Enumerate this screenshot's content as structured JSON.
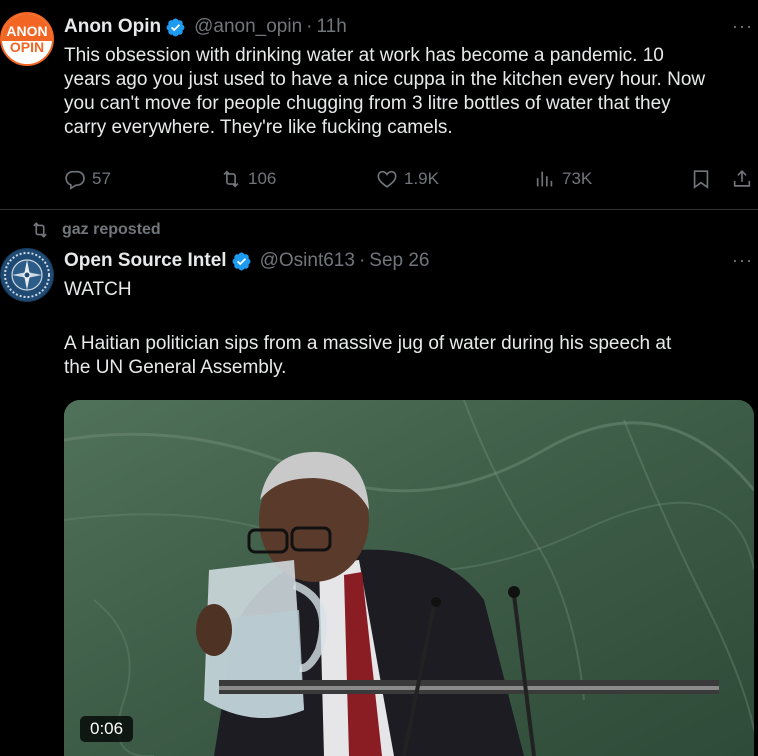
{
  "tweet1": {
    "avatar_lines": [
      "ANON",
      "OPIN"
    ],
    "display_name": "Anon Opin",
    "handle": "@anon_opin",
    "separator": "·",
    "time": "11h",
    "more": "···",
    "text_lines": [
      "This obsession with drinking water at work has become a pandemic. 10",
      "years ago you just used to have a nice cuppa in the kitchen every hour. Now",
      "you can't move for people chugging from 3 litre bottles of water that they",
      "carry everywhere. They're like fucking camels."
    ],
    "replies": "57",
    "reposts": "106",
    "likes": "1.9K",
    "views": "73K"
  },
  "repost_banner": "gaz reposted",
  "tweet2": {
    "display_name": "Open Source Intel",
    "handle": "@Osint613",
    "separator": "·",
    "time": "Sep 26",
    "more": "···",
    "text_line1": "WATCH",
    "text_lines": [
      "A Haitian politician sips from a massive jug of water during his speech at",
      "the UN General Assembly."
    ],
    "video_duration": "0:06"
  },
  "colors": {
    "background": "#000000",
    "text": "#e7e9ea",
    "muted": "#71767b",
    "verified": "#1d9bf0",
    "avatar_orange": "#f26522"
  },
  "icons": [
    "verified-badge-icon",
    "more-icon",
    "reply-icon",
    "repost-icon",
    "like-icon",
    "views-icon",
    "bookmark-icon",
    "share-icon",
    "play-duration"
  ]
}
